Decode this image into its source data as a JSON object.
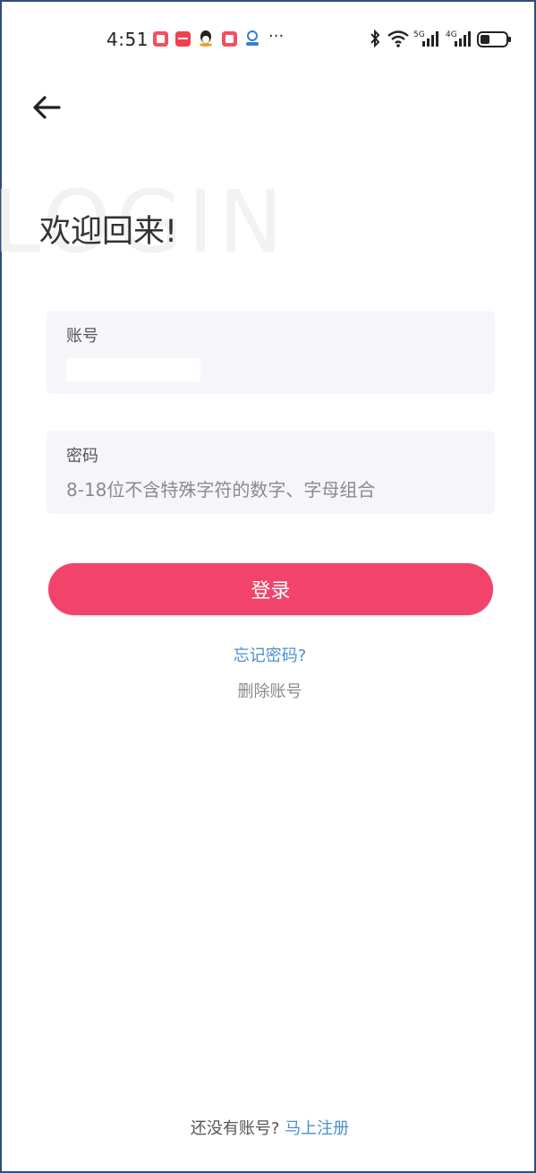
{
  "status_bar": {
    "time": "4:51",
    "icons": [
      "notification-app-icon",
      "notification-app-icon",
      "qq-icon",
      "notification-app-icon",
      "notification-app-icon",
      "more-notifications-icon",
      "bluetooth-icon",
      "wifi-icon",
      "signal-5g-icon",
      "signal-4g-icon",
      "battery-icon"
    ],
    "sig5_label": "5G",
    "sig4_label": "4G",
    "dots": "···"
  },
  "watermark": "LOGIN",
  "welcome": "欢迎回来!",
  "account": {
    "label": "账号",
    "value": ""
  },
  "password": {
    "label": "密码",
    "placeholder": "8-18位不含特殊字符的数字、字母组合"
  },
  "login_button": "登录",
  "forgot_password": "忘记密码?",
  "delete_account": "删除账号",
  "footer": {
    "prompt": "还没有账号? ",
    "register": "马上注册"
  },
  "colors": {
    "accent": "#f2436a",
    "link": "#4a8fd0",
    "field_bg": "#f6f6fa",
    "frame": "#2f4d7a"
  }
}
